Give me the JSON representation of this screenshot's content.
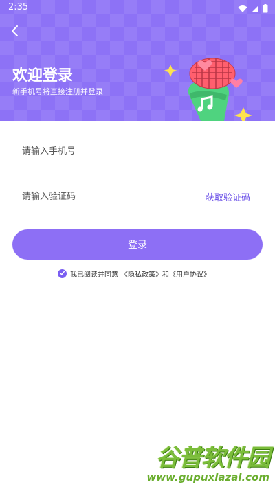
{
  "status_bar": {
    "time": "2:35"
  },
  "header": {
    "title": "欢迎登录",
    "subtitle": "新手机号将直接注册并登录",
    "mascot_icon": "microphone-mascot-icon"
  },
  "form": {
    "phone_placeholder": "请输入手机号",
    "code_placeholder": "请输入验证码",
    "get_code_label": "获取验证码",
    "login_label": "登录"
  },
  "agreement": {
    "prefix": "我已阅读并同意",
    "privacy": "《隐私政策》",
    "and": "和",
    "terms": "《用户协议》",
    "checked": true
  },
  "watermark": {
    "name": "谷普软件园",
    "url": "www.gupuxlazal.com"
  },
  "colors": {
    "header_bg": "#8d72f6",
    "accent": "#6c52e8",
    "button_bg": "#8d6ff5"
  }
}
